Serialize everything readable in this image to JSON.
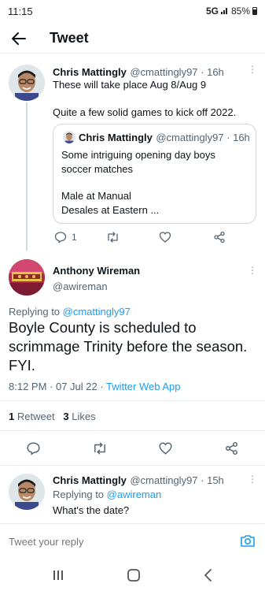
{
  "status": {
    "time": "11:15",
    "network": "5G",
    "battery": "85%"
  },
  "header": {
    "title": "Tweet"
  },
  "tweet1": {
    "name": "Chris Mattingly",
    "handle": "@cmattingly97 · 16h",
    "line1": "These will take place Aug 8/Aug 9",
    "line2": "Quite a few solid games to kick off 2022.",
    "quote": {
      "name": "Chris Mattingly",
      "handle": "@cmattingly97 · 16h",
      "line1": "Some intriguing opening day boys",
      "line2": "soccer matches",
      "line3": "Male at Manual",
      "line4": "Desales at Eastern ..."
    },
    "reply_count": "1"
  },
  "main": {
    "name": "Anthony Wireman",
    "handle": "@awireman",
    "replying_prefix": "Replying to ",
    "replying_to": "@cmattingly97",
    "text_line1": "Boyle County is scheduled to",
    "text_line2": "scrimmage Trinity before the season.",
    "text_line3": "FYI.",
    "time": "8:12 PM · 07 Jul 22 · ",
    "source": "Twitter Web App",
    "retweet_count": "1",
    "retweet_label": "Retweet",
    "like_count": "3",
    "like_label": "Likes"
  },
  "reply": {
    "name": "Chris Mattingly",
    "handle": "@cmattingly97 · 15h",
    "replying_prefix": "Replying to ",
    "replying_to": "@awireman",
    "text": "What's the date?"
  },
  "composer": {
    "placeholder": "Tweet your reply"
  },
  "colors": {
    "accent": "#1d9bf0",
    "text": "#0f1419",
    "muted": "#536471",
    "border": "#cfd9de"
  }
}
